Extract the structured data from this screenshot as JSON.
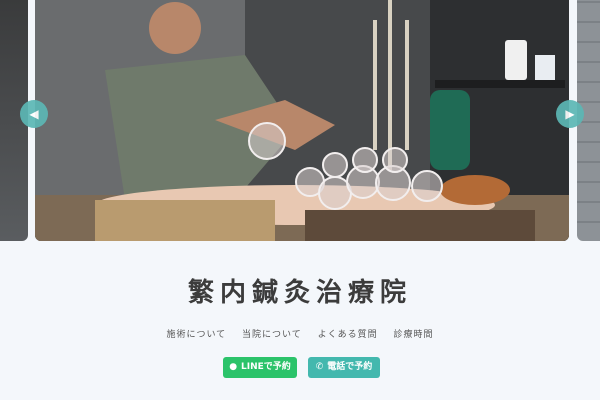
{
  "carousel": {
    "prev_icon": "chevron-left-icon",
    "next_icon": "chevron-right-icon",
    "prev_glyph": "◀",
    "next_glyph": "▶"
  },
  "brand": {
    "name": "繁内鍼灸治療院"
  },
  "nav": {
    "items": [
      "施術について",
      "当院について",
      "よくある質問",
      "診療時間"
    ]
  },
  "cta": {
    "line_label": "LINEで予約",
    "line_icon": "line-chat-icon",
    "line_glyph": "●",
    "tel_label": "電話で予約",
    "tel_icon": "phone-icon",
    "tel_glyph": "✆"
  },
  "colors": {
    "accent": "#43b8ae",
    "line_green": "#2bc36a",
    "arrow": "#5cb7b5",
    "background": "#f4f7fb"
  }
}
